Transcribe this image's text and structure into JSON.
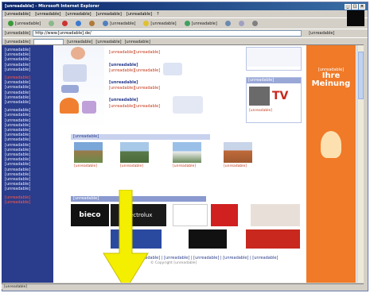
{
  "window": {
    "title": "[unreadable] - Microsoft Internet Explorer"
  },
  "menu": {
    "items": [
      "[unreadable]",
      "[unreadable]",
      "[unreadable]",
      "[unreadable]",
      "[unreadable]",
      "?"
    ]
  },
  "toolbar": {
    "back": "[unreadable]",
    "search": "[unreadable]",
    "favorites": "[unreadable]",
    "media": "[unreadable]"
  },
  "address": {
    "label": "[unreadable]",
    "value": "http://www.[unreadable].de/",
    "links_label": "[unreadable]"
  },
  "linksbar": {
    "label": "[unreadable]",
    "btn1": "[unreadable]",
    "btn2": "[unreadable]",
    "btn3": "[unreadable]"
  },
  "sidebar": {
    "group1": [
      "[unreadable]",
      "[unreadable]",
      "[unreadable]",
      "[unreadable]",
      "[unreadable]"
    ],
    "group2_head": "[unreadable]",
    "group2": [
      "[unreadable]",
      "[unreadable]",
      "[unreadable]",
      "[unreadable]",
      "[unreadable]"
    ],
    "group3": [
      "[unreadable]",
      "[unreadable]",
      "[unreadable]",
      "[unreadable]",
      "[unreadable]",
      "[unreadable]",
      "[unreadable]",
      "[unreadable]",
      "[unreadable]",
      "[unreadable]",
      "[unreadable]",
      "[unreadable]",
      "[unreadable]",
      "[unreadable]",
      "[unreadable]",
      "[unreadable]",
      "[unreadable]"
    ],
    "group4": [
      "[unreadable]",
      "[unreadable]"
    ]
  },
  "content": {
    "rows": [
      {
        "title": "[unreadable]",
        "a": "[unreadable]",
        "b": "[unreadable]"
      },
      {
        "title": "[unreadable]",
        "a": "[unreadable]",
        "b": "[unreadable]"
      },
      {
        "title": "[unreadable]",
        "a": "[unreadable]",
        "b": "[unreadable]"
      },
      {
        "title": "[unreadable]",
        "a": "[unreadable]",
        "b": "[unreadable]"
      }
    ],
    "section_bar": "[unreadable]",
    "photos": [
      {
        "caption": "[unreadable]"
      },
      {
        "caption": "[unreadable]"
      },
      {
        "caption": "[unreadable]"
      },
      {
        "caption": "[unreadable]"
      }
    ],
    "partner_bar": "[unreadable]",
    "logos": [
      "bieco",
      "Electrolux",
      "[unreadable]",
      "[unreadable]"
    ],
    "tv_card": "[unreadable]",
    "tv_title": "TV",
    "tv_link": "[unreadable]"
  },
  "banner": {
    "line1": "[unreadable]",
    "line2": "Ihre",
    "line3": "Meinung"
  },
  "footer": {
    "links": "[unreadable] | [unreadable] | [unreadable] | [unreadable] | [unreadable]",
    "copyright": "© Copyright [unreadable]"
  },
  "status": {
    "text": "[unreadable]"
  },
  "colors": {
    "accent_blue": "#2a3c8c",
    "orange": "#f07a28",
    "arrow_yellow": "#f4ee00"
  }
}
